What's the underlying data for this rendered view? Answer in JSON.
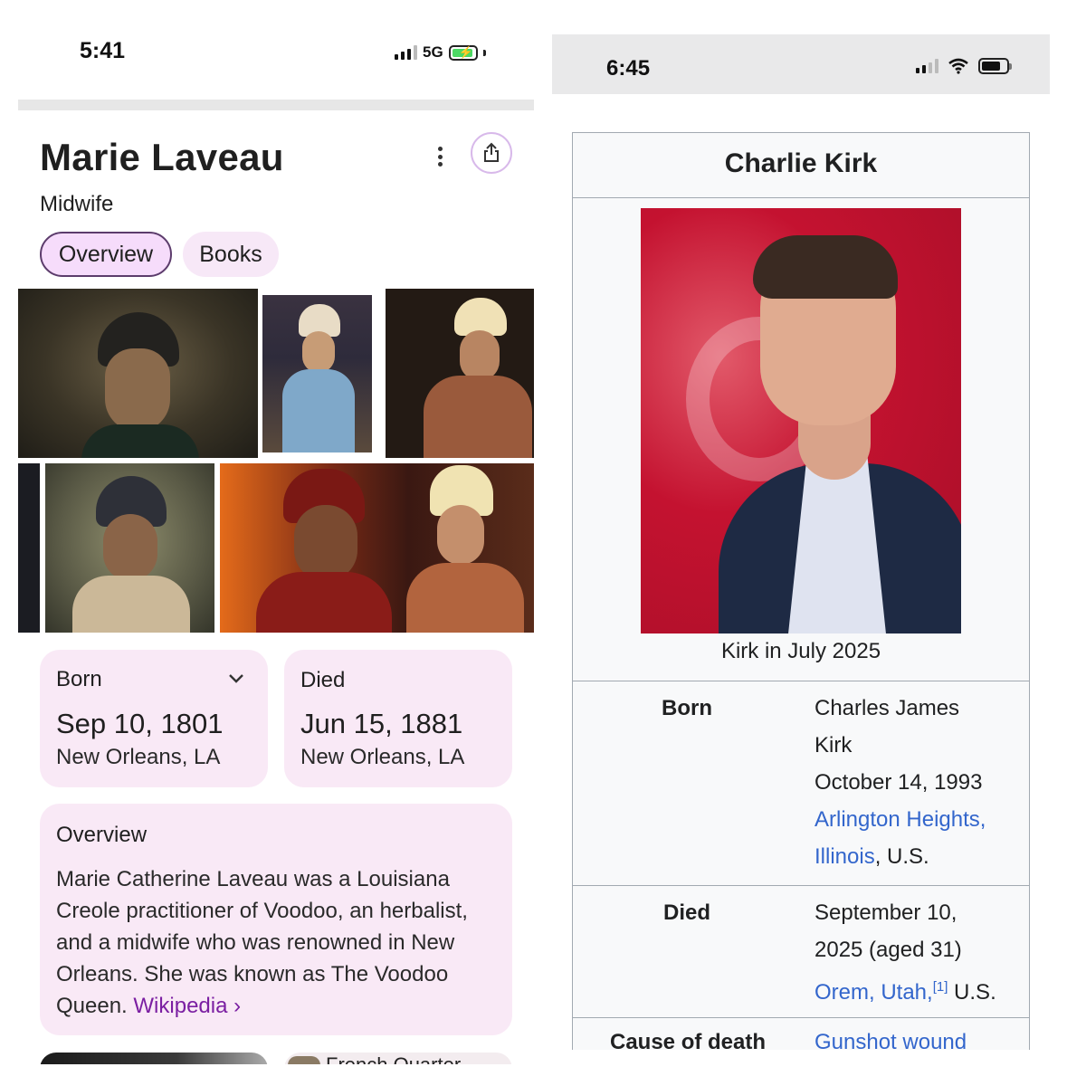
{
  "left": {
    "status_bar": {
      "time": "5:41",
      "network": "5G"
    },
    "entity": {
      "name": "Marie Laveau",
      "subtitle": "Midwife"
    },
    "tabs": [
      {
        "label": "Overview",
        "active": true
      },
      {
        "label": "Books",
        "active": false
      }
    ],
    "born": {
      "label": "Born",
      "date": "Sep 10, 1801",
      "place": "New Orleans, LA"
    },
    "died": {
      "label": "Died",
      "date": "Jun 15, 1881",
      "place": "New Orleans, LA"
    },
    "overview": {
      "heading": "Overview",
      "text": "Marie Catherine Laveau was a Louisiana Creole practitioner of Voodoo, an herbalist, and a midwife who was renowned in New Orleans. She was known as The Voodoo Queen.",
      "source_link": "Wikipedia ›"
    },
    "bottom_card_label": "French Quarter"
  },
  "right": {
    "status_bar": {
      "time": "6:45"
    },
    "infobox": {
      "title": "Charlie Kirk",
      "caption": "Kirk in July 2025",
      "born_label": "Born",
      "born_name_1": "Charles James",
      "born_name_2": "Kirk",
      "born_date": "October 14, 1993",
      "born_place_link_1": "Arlington Heights,",
      "born_place_link_2": "Illinois",
      "born_place_suffix": ", U.S.",
      "died_label": "Died",
      "died_date_1": "September 10,",
      "died_date_2": "2025 (aged 31)",
      "died_place_link": "Orem, Utah,",
      "died_ref": "[1]",
      "died_place_suffix": " U.S.",
      "cause_label": "Cause of death",
      "cause_value": "Gunshot wound"
    }
  },
  "colors": {
    "card_bg": "#f9e9f6",
    "chip_active_bg": "#f6dcfb",
    "wikipedia_link": "#7b1fa2",
    "wiki_link_blue": "#3366cc",
    "infobox_bg": "#f8f9fa",
    "photo_bg": "#c41230"
  }
}
